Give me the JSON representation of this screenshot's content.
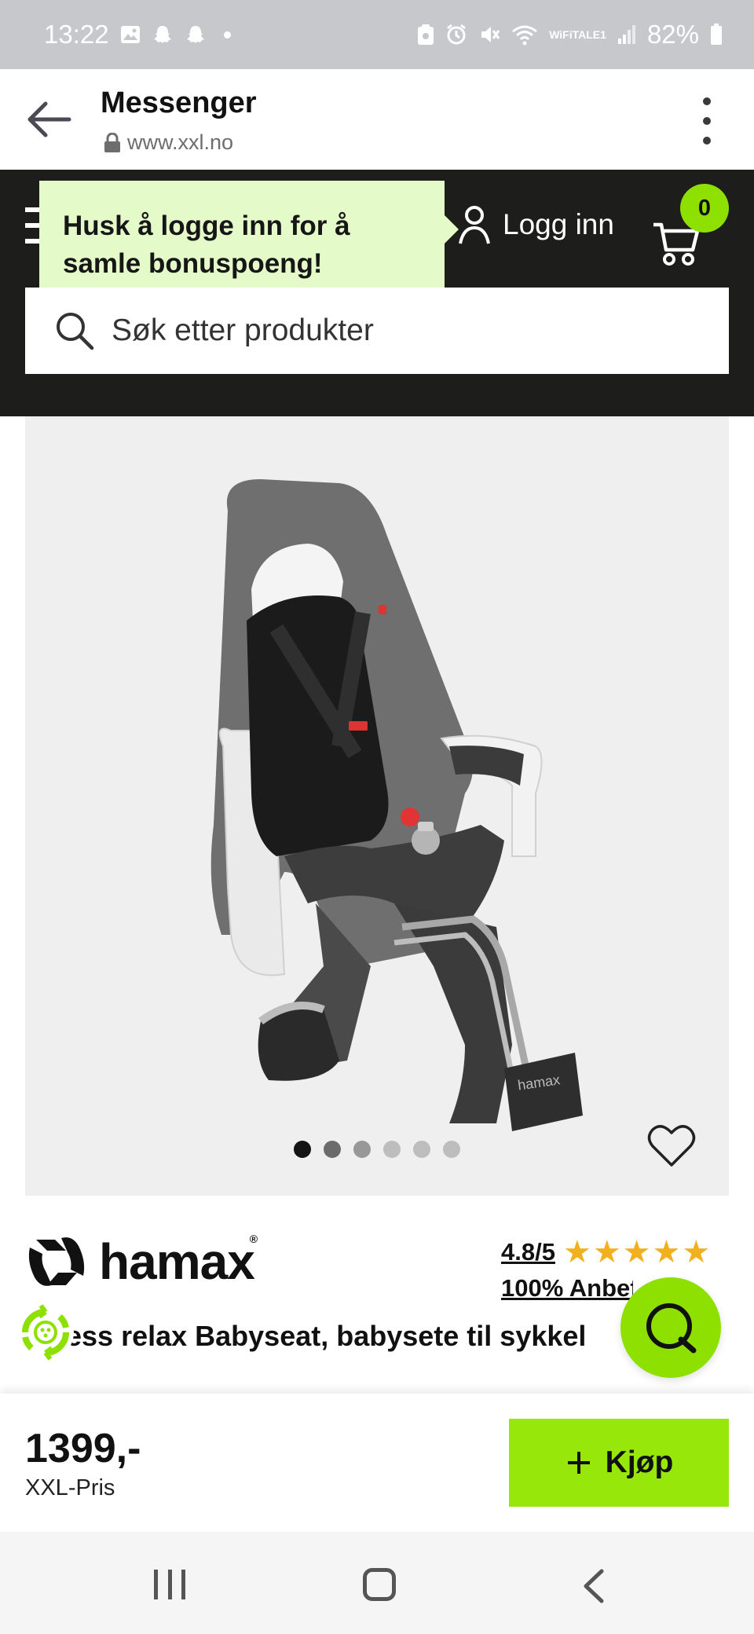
{
  "status_bar": {
    "time": "13:22",
    "battery": "82%",
    "wifi_label_top": "WiFi",
    "wifi_label_bottom": "TALE1",
    "icons": [
      "image-icon",
      "snapchat-icon",
      "snapchat-icon",
      "dot-icon",
      "clipboard-icon",
      "alarm-icon",
      "mute-icon",
      "wifi-icon",
      "signal-icon",
      "battery-icon"
    ]
  },
  "browser": {
    "title": "Messenger",
    "url": "www.xxl.no"
  },
  "site_header": {
    "tooltip": "Husk å logge inn for å samle bonuspoeng!",
    "login_label": "Logg inn",
    "cart_count": "0",
    "search_placeholder": "Søk etter produkter"
  },
  "gallery": {
    "dots_total": 6,
    "active_dot": 0,
    "image_brand_text": "hamax"
  },
  "product": {
    "brand": "hamax",
    "rating": "4.8/5",
    "stars": 5,
    "recommend": "100% Anbefaler",
    "title": "ess relax Babyseat, babysete til sykkel"
  },
  "buy_bar": {
    "price": "1399,-",
    "price_label": "XXL-Pris",
    "buy_label": "Kjøp"
  },
  "colors": {
    "accent_green": "#8ee000",
    "header_dark": "#1d1d1b",
    "tooltip_bg": "#e4fbc9",
    "star": "#f2b01e"
  }
}
